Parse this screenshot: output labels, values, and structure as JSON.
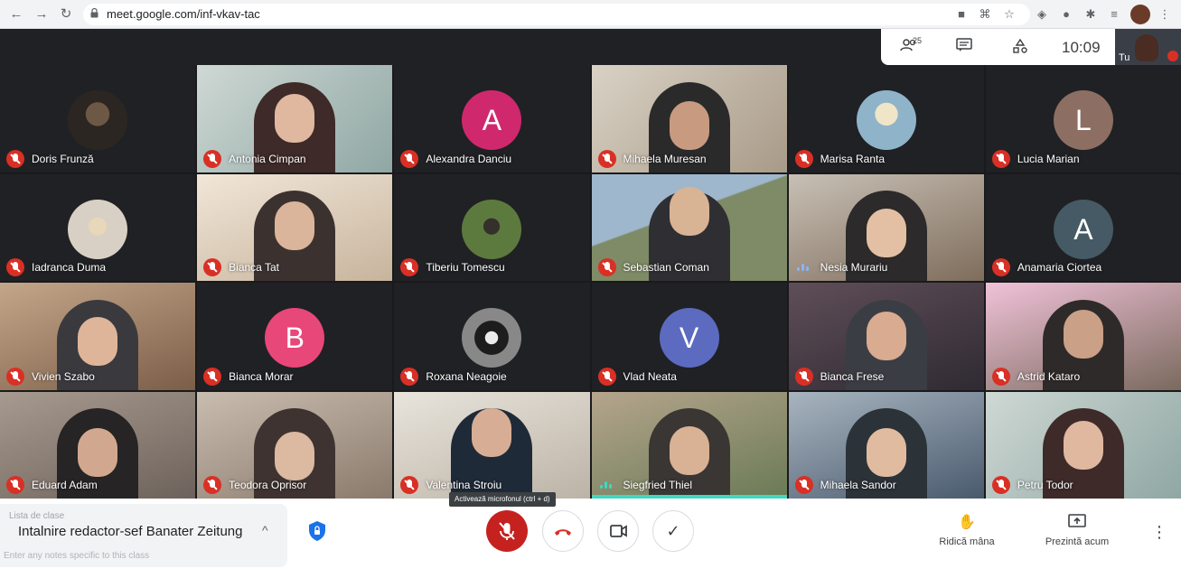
{
  "browser": {
    "url": "meet.google.com/inf-vkav-tac"
  },
  "meeting": {
    "participant_count": "25",
    "time": "10:09",
    "self_label": "Tu",
    "mic_tooltip": "Activează microfonul (ctrl + d)"
  },
  "class_panel": {
    "hint": "Lista de clase",
    "title": "Intalnire redactor-sef Banater Zeitung",
    "notes_placeholder": "Enter any notes specific to this class"
  },
  "actions": {
    "raise_hand": "Ridică mâna",
    "present": "Prezintă acum"
  },
  "participants": [
    {
      "name": "Doris Frunză",
      "type": "photo",
      "avatar_style": "pic",
      "mic": "muted"
    },
    {
      "name": "Antonia Cimpan",
      "type": "video",
      "mic": "muted"
    },
    {
      "name": "Alexandra Danciu",
      "type": "letter",
      "letter": "A",
      "color": "#d0286d",
      "mic": "muted"
    },
    {
      "name": "Mihaela Muresan",
      "type": "video",
      "mic": "muted"
    },
    {
      "name": "Marisa Ranta",
      "type": "photo",
      "avatar_style": "pic4",
      "mic": "muted"
    },
    {
      "name": "Lucia Marian",
      "type": "letter",
      "letter": "L",
      "color": "#8d6e63",
      "mic": "muted"
    },
    {
      "name": "Iadranca Duma",
      "type": "photo",
      "avatar_style": "pic2",
      "mic": "muted"
    },
    {
      "name": "Bianca Tat",
      "type": "video",
      "mic": "muted"
    },
    {
      "name": "Tiberiu Tomescu",
      "type": "photo",
      "avatar_style": "pic3",
      "mic": "muted"
    },
    {
      "name": "Sebastian Coman",
      "type": "video",
      "mic": "muted"
    },
    {
      "name": "Nesia Murariu",
      "type": "video",
      "mic": "speaking"
    },
    {
      "name": "Anamaria Ciortea",
      "type": "letter",
      "letter": "A",
      "color": "#455a64",
      "mic": "muted"
    },
    {
      "name": "Vivien Szabo",
      "type": "video",
      "mic": "muted"
    },
    {
      "name": "Bianca Morar",
      "type": "letter",
      "letter": "B",
      "color": "#e8477a",
      "mic": "muted"
    },
    {
      "name": "Roxana Neagoie",
      "type": "photo",
      "avatar_style": "pic5",
      "mic": "muted"
    },
    {
      "name": "Vlad Neata",
      "type": "letter",
      "letter": "V",
      "color": "#5c6bc0",
      "mic": "muted"
    },
    {
      "name": "Bianca Frese",
      "type": "video",
      "mic": "muted"
    },
    {
      "name": "Astrid Kataro",
      "type": "video",
      "mic": "muted"
    },
    {
      "name": "Eduard Adam",
      "type": "video",
      "mic": "muted"
    },
    {
      "name": "Teodora Oprisor",
      "type": "video",
      "mic": "muted"
    },
    {
      "name": "Valentina Stroiu",
      "type": "video",
      "mic": "muted"
    },
    {
      "name": "Siegfried Thiel",
      "type": "video",
      "mic": "active"
    },
    {
      "name": "Mihaela Sandor",
      "type": "video",
      "mic": "muted"
    },
    {
      "name": "Petru Todor",
      "type": "video",
      "mic": "muted"
    }
  ],
  "colors": {
    "muted_mic": "#d93025",
    "active_speaker": "#3fd8c1",
    "background": "#202124"
  }
}
